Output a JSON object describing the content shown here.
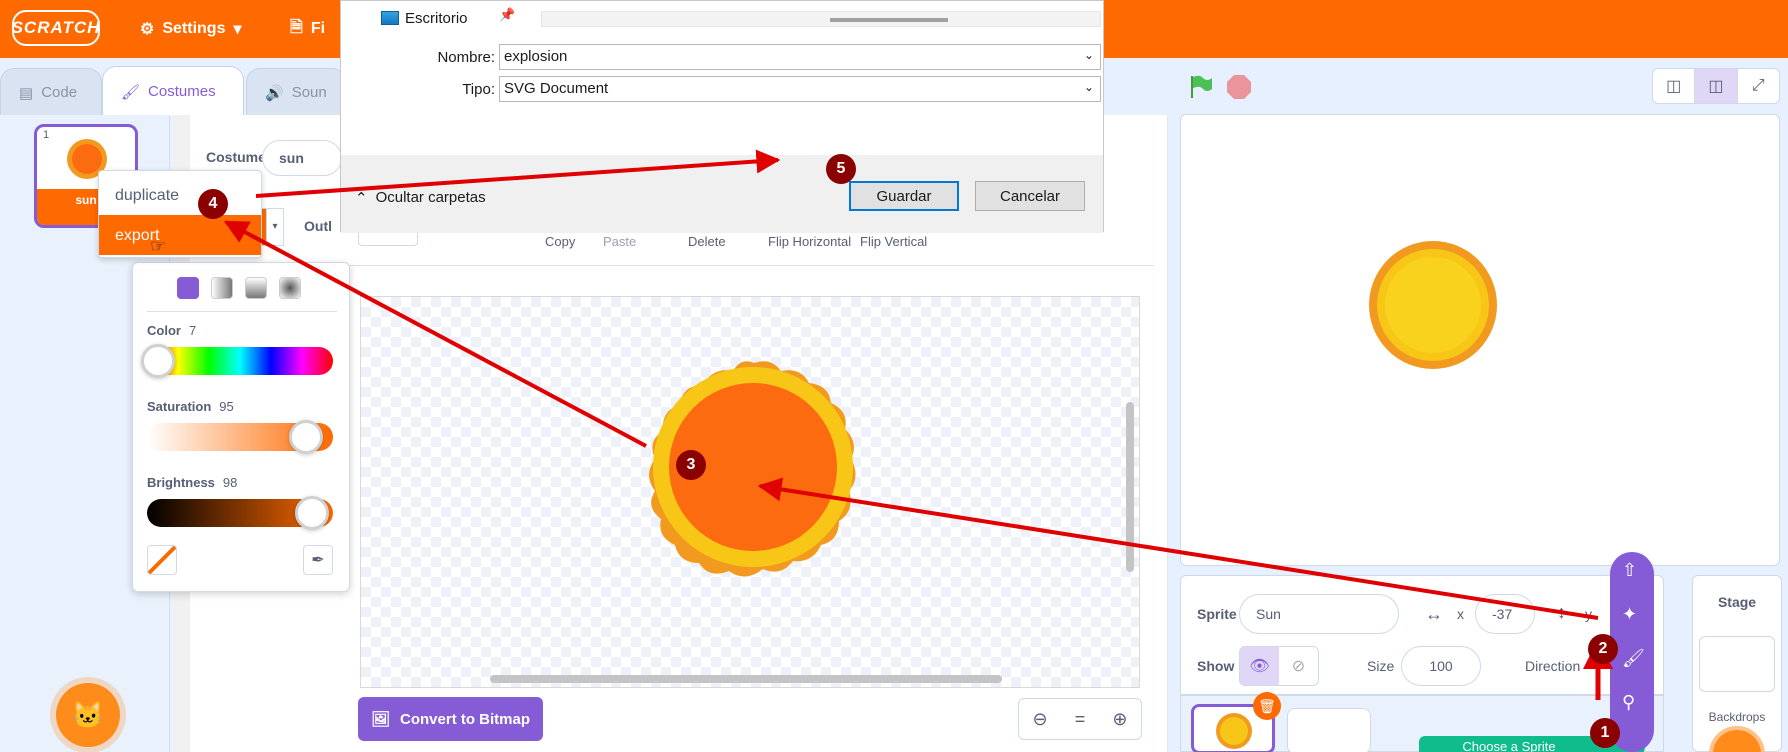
{
  "menubar": {
    "logo": "SCRATCH",
    "settings": "Settings",
    "file": "Fi"
  },
  "tabs": {
    "code": "Code",
    "costumes": "Costumes",
    "sounds": "Soun"
  },
  "costume": {
    "number": "1",
    "name_label": "sun",
    "field_label": "Costume",
    "field_value": "sun",
    "outline_label": "Outl"
  },
  "context_menu": {
    "duplicate": "duplicate",
    "export": "export"
  },
  "toolbar": {
    "copy": "Copy",
    "paste": "Paste",
    "delete": "Delete",
    "flip_h": "Flip Horizontal",
    "flip_v": "Flip Vertical"
  },
  "color_picker": {
    "color_label": "Color",
    "color_value": "7",
    "saturation_label": "Saturation",
    "saturation_value": "95",
    "brightness_label": "Brightness",
    "brightness_value": "98"
  },
  "editor": {
    "convert_button": "Convert to Bitmap"
  },
  "sprite_info": {
    "sprite_label": "Sprite",
    "sprite_name": "Sun",
    "x_label": "x",
    "x_value": "-37",
    "y_label": "y",
    "show_label": "Show",
    "size_label": "Size",
    "size_value": "100",
    "direction_label": "Direction"
  },
  "stage_panel": {
    "title": "Stage",
    "backdrops": "Backdrops"
  },
  "sprite_list": {
    "choose_sprite": "Choose a Sprite"
  },
  "save_dialog": {
    "location": "Escritorio",
    "name_label": "Nombre:",
    "name_value": "explosion",
    "type_label": "Tipo:",
    "type_value": "SVG Document",
    "hide_folders": "Ocultar carpetas",
    "save_button": "Guardar",
    "cancel_button": "Cancelar"
  },
  "annotations": [
    "1",
    "2",
    "3",
    "4",
    "5"
  ],
  "colors": {
    "scratch_orange": "#ff6a00",
    "scratch_purple": "#855cd6",
    "arrow_red": "#e00000",
    "badge": "#8b0000",
    "sun_orange": "#fc6b0f",
    "sun_yellow": "#f7c617"
  }
}
